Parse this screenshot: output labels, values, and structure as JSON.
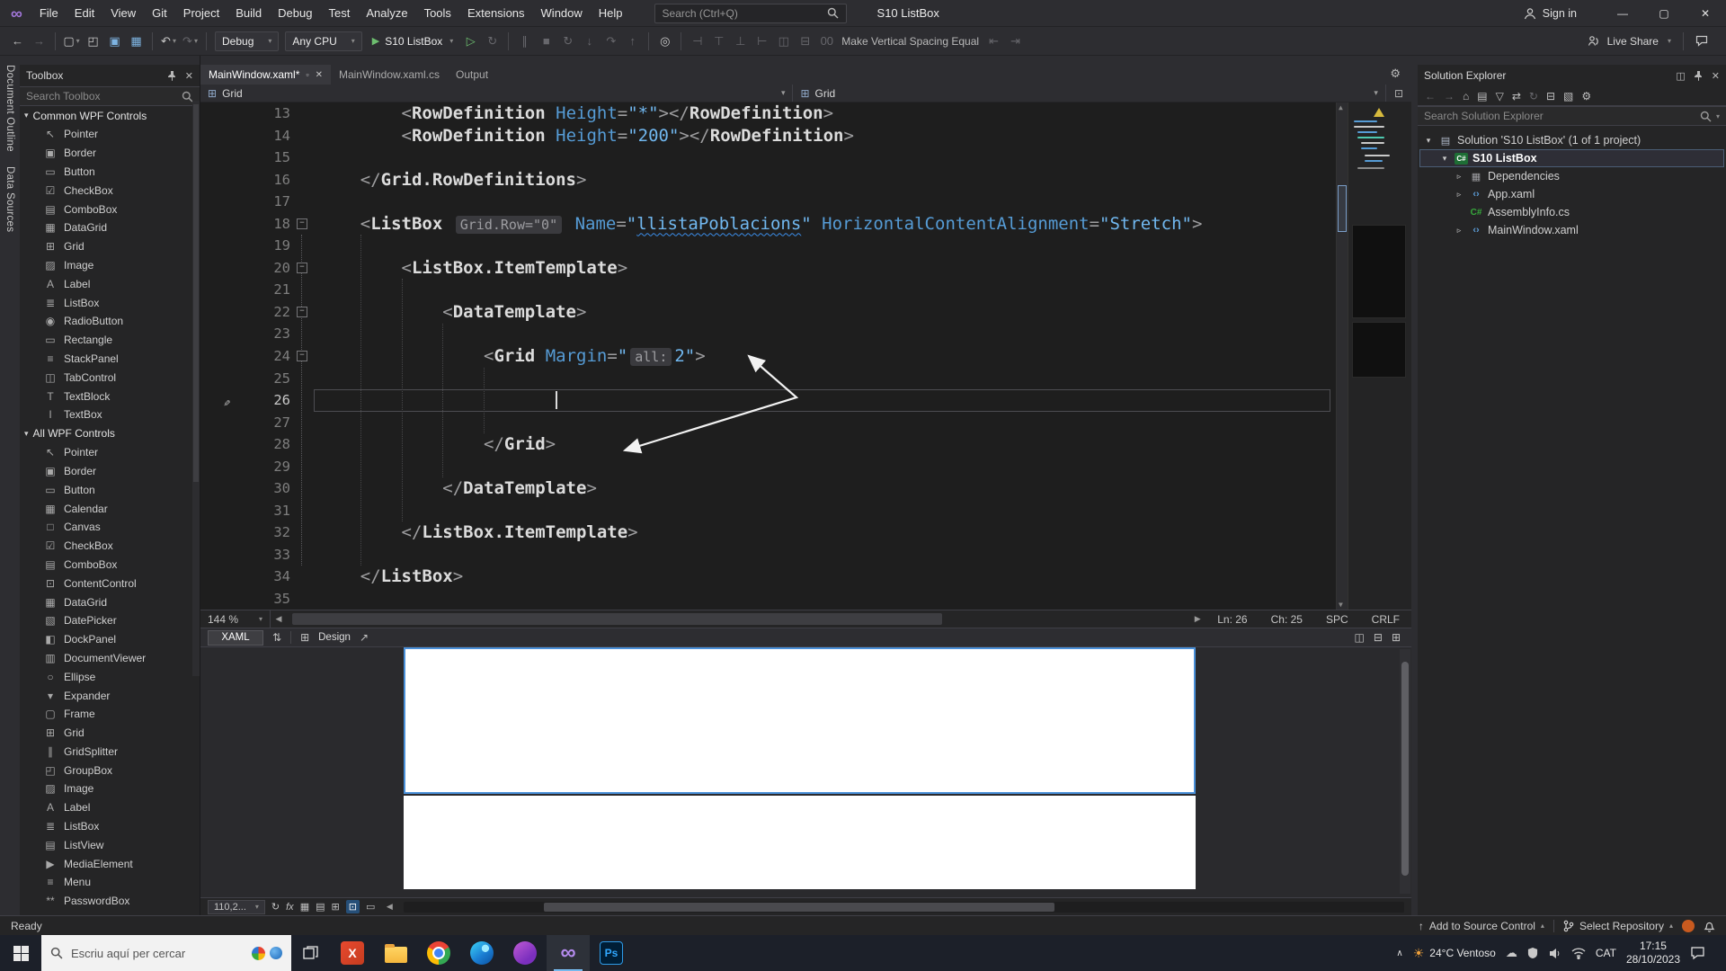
{
  "titlebar": {
    "menus": [
      "File",
      "Edit",
      "View",
      "Git",
      "Project",
      "Build",
      "Debug",
      "Test",
      "Analyze",
      "Tools",
      "Extensions",
      "Window",
      "Help"
    ],
    "search": "Search (Ctrl+Q)",
    "title": "S10 ListBox",
    "sign_in": "Sign in",
    "win_min": "—",
    "win_max": "▢",
    "win_close": "✕"
  },
  "toolbar": {
    "live_share": "Live Share",
    "items": [
      {
        "t": "icon",
        "n": "nav-back-icon",
        "g": "←"
      },
      {
        "t": "icon",
        "n": "nav-forward-icon",
        "g": "→",
        "d": 1
      },
      {
        "t": "sep"
      },
      {
        "t": "icon",
        "n": "new-file-icon",
        "g": "▢",
        "c": 1
      },
      {
        "t": "icon",
        "n": "open-file-icon",
        "g": "◰"
      },
      {
        "t": "icon",
        "n": "save-icon",
        "g": "▣",
        "tint": "#7EB4E2"
      },
      {
        "t": "icon",
        "n": "save-all-icon",
        "g": "▦",
        "tint": "#7EB4E2"
      },
      {
        "t": "sep"
      },
      {
        "t": "icon",
        "n": "undo-icon",
        "g": "↶",
        "c": 1
      },
      {
        "t": "icon",
        "n": "redo-icon",
        "g": "↷",
        "d": 1,
        "c": 1
      },
      {
        "t": "sep"
      },
      {
        "t": "dd",
        "n": "solution-configuration-dropdown",
        "label": "Debug"
      },
      {
        "t": "dd",
        "n": "solution-platform-dropdown",
        "label": "Any CPU"
      },
      {
        "t": "run",
        "n": "start-debugging-button",
        "label": "S10 ListBox"
      },
      {
        "t": "icon",
        "n": "start-without-debugging-icon",
        "g": "▷",
        "tint": "#6DBE6F"
      },
      {
        "t": "icon",
        "n": "hot-reload-icon",
        "g": "↻",
        "d": 1
      },
      {
        "t": "sep"
      },
      {
        "t": "icon",
        "n": "break-all-icon",
        "g": "∥",
        "d": 1
      },
      {
        "t": "icon",
        "n": "stop-icon",
        "g": "■",
        "d": 1
      },
      {
        "t": "icon",
        "n": "restart-icon",
        "g": "↻",
        "d": 1
      },
      {
        "t": "icon",
        "n": "step-into-icon",
        "g": "↓",
        "d": 1
      },
      {
        "t": "icon",
        "n": "step-over-icon",
        "g": "↷",
        "d": 1
      },
      {
        "t": "icon",
        "n": "step-out-icon",
        "g": "↑",
        "d": 1
      },
      {
        "t": "sep"
      },
      {
        "t": "icon",
        "n": "find-in-files-icon",
        "g": "◎"
      },
      {
        "t": "sep"
      },
      {
        "t": "icon",
        "n": "align-left-edges-icon",
        "g": "⊣",
        "d": 1
      },
      {
        "t": "icon",
        "n": "align-tops-icon",
        "g": "⊤",
        "d": 1
      },
      {
        "t": "icon",
        "n": "align-bottoms-icon",
        "g": "⊥",
        "d": 1
      },
      {
        "t": "icon",
        "n": "align-right-edges-icon",
        "g": "⊢",
        "d": 1
      },
      {
        "t": "icon",
        "n": "make-same-width-icon",
        "g": "◫",
        "d": 1
      },
      {
        "t": "icon",
        "n": "make-same-height-icon",
        "g": "⊟",
        "d": 1
      },
      {
        "t": "icon",
        "n": "make-same-size-icon",
        "g": "00",
        "d": 1
      },
      {
        "t": "label",
        "n": "spacing-command-label",
        "label": "Make Vertical Spacing Equal"
      },
      {
        "t": "icon",
        "n": "horizontal-spacing-icon",
        "g": "⇤",
        "d": 1
      },
      {
        "t": "icon",
        "n": "vertical-spacing-icon",
        "g": "⇥",
        "d": 1
      }
    ]
  },
  "side_tabs": [
    "Document Outline",
    "Data Sources"
  ],
  "toolbox": {
    "title": "Toolbox",
    "search_placeholder": "Search Toolbox",
    "sections": [
      {
        "label": "Common WPF Controls",
        "items": [
          {
            "label": "Pointer",
            "icon": "pointer",
            "g": "↖"
          },
          {
            "label": "Border",
            "icon": "border",
            "g": "▣"
          },
          {
            "label": "Button",
            "icon": "button",
            "g": "▭"
          },
          {
            "label": "CheckBox",
            "icon": "checkbox",
            "g": "☑"
          },
          {
            "label": "ComboBox",
            "icon": "combobox",
            "g": "▤"
          },
          {
            "label": "DataGrid",
            "icon": "datagrid",
            "g": "▦"
          },
          {
            "label": "Grid",
            "icon": "grid",
            "g": "⊞"
          },
          {
            "label": "Image",
            "icon": "image",
            "g": "▨"
          },
          {
            "label": "Label",
            "icon": "label",
            "g": "A"
          },
          {
            "label": "ListBox",
            "icon": "listbox",
            "g": "≣"
          },
          {
            "label": "RadioButton",
            "icon": "radiobutton",
            "g": "◉"
          },
          {
            "label": "Rectangle",
            "icon": "rectangle",
            "g": "▭"
          },
          {
            "label": "StackPanel",
            "icon": "stackpanel",
            "g": "≡"
          },
          {
            "label": "TabControl",
            "icon": "tabcontrol",
            "g": "◫"
          },
          {
            "label": "TextBlock",
            "icon": "textblock",
            "g": "T"
          },
          {
            "label": "TextBox",
            "icon": "textbox",
            "g": "I"
          }
        ]
      },
      {
        "label": "All WPF Controls",
        "items": [
          {
            "label": "Pointer",
            "icon": "pointer",
            "g": "↖"
          },
          {
            "label": "Border",
            "icon": "border",
            "g": "▣"
          },
          {
            "label": "Button",
            "icon": "button",
            "g": "▭"
          },
          {
            "label": "Calendar",
            "icon": "calendar",
            "g": "▦"
          },
          {
            "label": "Canvas",
            "icon": "canvas",
            "g": "□"
          },
          {
            "label": "CheckBox",
            "icon": "checkbox",
            "g": "☑"
          },
          {
            "label": "ComboBox",
            "icon": "combobox",
            "g": "▤"
          },
          {
            "label": "ContentControl",
            "icon": "contentcontrol",
            "g": "⊡"
          },
          {
            "label": "DataGrid",
            "icon": "datagrid",
            "g": "▦"
          },
          {
            "label": "DatePicker",
            "icon": "datepicker",
            "g": "▧"
          },
          {
            "label": "DockPanel",
            "icon": "dockpanel",
            "g": "◧"
          },
          {
            "label": "DocumentViewer",
            "icon": "documentviewer",
            "g": "▥"
          },
          {
            "label": "Ellipse",
            "icon": "ellipse",
            "g": "○"
          },
          {
            "label": "Expander",
            "icon": "expander",
            "g": "▾"
          },
          {
            "label": "Frame",
            "icon": "frame",
            "g": "▢"
          },
          {
            "label": "Grid",
            "icon": "grid",
            "g": "⊞"
          },
          {
            "label": "GridSplitter",
            "icon": "gridsplitter",
            "g": "∥"
          },
          {
            "label": "GroupBox",
            "icon": "groupbox",
            "g": "◰"
          },
          {
            "label": "Image",
            "icon": "image",
            "g": "▨"
          },
          {
            "label": "Label",
            "icon": "label",
            "g": "A"
          },
          {
            "label": "ListBox",
            "icon": "listbox",
            "g": "≣"
          },
          {
            "label": "ListView",
            "icon": "listview",
            "g": "▤"
          },
          {
            "label": "MediaElement",
            "icon": "mediaelement",
            "g": "▶"
          },
          {
            "label": "Menu",
            "icon": "menu",
            "g": "≡"
          },
          {
            "label": "PasswordBox",
            "icon": "passwordbox",
            "g": "**"
          }
        ]
      }
    ]
  },
  "editor": {
    "tabs": [
      {
        "label": "MainWindow.xaml*",
        "active": true
      },
      {
        "label": "MainWindow.xaml.cs"
      },
      {
        "label": "Output"
      }
    ],
    "breadcrumb": [
      "Grid",
      "Grid"
    ],
    "zoom": "144 %",
    "ln": "Ln: 26",
    "ch": "Ch: 25",
    "ins": "SPC",
    "eol": "CRLF",
    "fold_lines": [
      18,
      20,
      22,
      24
    ],
    "lines": [
      {
        "n": 13,
        "t": [
          [
            "        <",
            "pl"
          ],
          [
            "RowDefinition",
            "tag"
          ],
          [
            " ",
            "pl"
          ],
          [
            "Height",
            "at"
          ],
          [
            "=",
            "pl"
          ],
          [
            "\"*\"",
            "vl"
          ],
          [
            "></",
            "pl"
          ],
          [
            "RowDefinition",
            "tag"
          ],
          [
            ">",
            "pl"
          ]
        ]
      },
      {
        "n": 14,
        "t": [
          [
            "        <",
            "pl"
          ],
          [
            "RowDefinition",
            "tag"
          ],
          [
            " ",
            "pl"
          ],
          [
            "Height",
            "at"
          ],
          [
            "=",
            "pl"
          ],
          [
            "\"200\"",
            "vl"
          ],
          [
            "></",
            "pl"
          ],
          [
            "RowDefinition",
            "tag"
          ],
          [
            ">",
            "pl"
          ]
        ]
      },
      {
        "n": 15,
        "t": []
      },
      {
        "n": 16,
        "t": [
          [
            "    </",
            "pl"
          ],
          [
            "Grid.RowDefinitions",
            "tag"
          ],
          [
            ">",
            "pl"
          ]
        ]
      },
      {
        "n": 17,
        "t": []
      },
      {
        "n": 18,
        "t": [
          [
            "    <",
            "pl"
          ],
          [
            "ListBox",
            "tag"
          ],
          [
            " ",
            "pl"
          ],
          [
            "Grid.Row=\"0\"",
            "hint"
          ],
          [
            " ",
            "pl"
          ],
          [
            "Name",
            "at"
          ],
          [
            "=",
            "pl"
          ],
          [
            "\"",
            "vl"
          ],
          [
            "llistaPoblacions",
            "vlu"
          ],
          [
            "\"",
            "vl"
          ],
          [
            " ",
            "pl"
          ],
          [
            "HorizontalContentAlignment",
            "at"
          ],
          [
            "=",
            "pl"
          ],
          [
            "\"Stretch\"",
            "vl"
          ],
          [
            ">",
            "pl"
          ]
        ]
      },
      {
        "n": 19,
        "t": []
      },
      {
        "n": 20,
        "t": [
          [
            "        <",
            "pl"
          ],
          [
            "ListBox.ItemTemplate",
            "tag"
          ],
          [
            ">",
            "pl"
          ]
        ]
      },
      {
        "n": 21,
        "t": []
      },
      {
        "n": 22,
        "t": [
          [
            "            <",
            "pl"
          ],
          [
            "DataTemplate",
            "tag"
          ],
          [
            ">",
            "pl"
          ]
        ]
      },
      {
        "n": 23,
        "t": []
      },
      {
        "n": 24,
        "t": [
          [
            "                <",
            "pl"
          ],
          [
            "Grid",
            "tag"
          ],
          [
            " ",
            "pl"
          ],
          [
            "Margin",
            "at"
          ],
          [
            "=",
            "pl"
          ],
          [
            "\"",
            "vl"
          ],
          [
            "all:",
            "hint"
          ],
          [
            "2\"",
            "vl"
          ],
          [
            ">",
            "pl"
          ]
        ]
      },
      {
        "n": 25,
        "t": []
      },
      {
        "n": 26,
        "t": [],
        "cur": true
      },
      {
        "n": 27,
        "t": []
      },
      {
        "n": 28,
        "t": [
          [
            "                </",
            "pl"
          ],
          [
            "Grid",
            "tag"
          ],
          [
            ">",
            "pl"
          ]
        ]
      },
      {
        "n": 29,
        "t": []
      },
      {
        "n": 30,
        "t": [
          [
            "            </",
            "pl"
          ],
          [
            "DataTemplate",
            "tag"
          ],
          [
            ">",
            "pl"
          ]
        ]
      },
      {
        "n": 31,
        "t": []
      },
      {
        "n": 32,
        "t": [
          [
            "        </",
            "pl"
          ],
          [
            "ListBox.ItemTemplate",
            "tag"
          ],
          [
            ">",
            "pl"
          ]
        ]
      },
      {
        "n": 33,
        "t": []
      },
      {
        "n": 34,
        "t": [
          [
            "    </",
            "pl"
          ],
          [
            "ListBox",
            "tag"
          ],
          [
            ">",
            "pl"
          ]
        ]
      },
      {
        "n": 35,
        "t": []
      }
    ]
  },
  "design": {
    "xaml_label": "XAML",
    "design_label": "Design",
    "zoom": "110,2..."
  },
  "solution": {
    "title": "Solution Explorer",
    "search_placeholder": "Search Solution Explorer",
    "toolbar": [
      {
        "n": "se-back-icon",
        "g": "←",
        "d": 1
      },
      {
        "n": "se-forward-icon",
        "g": "→",
        "d": 1
      },
      {
        "n": "se-home-icon",
        "g": "⌂"
      },
      {
        "n": "se-switch-views-icon",
        "g": "▤"
      },
      {
        "n": "se-pending-changes-filter-icon",
        "g": "▽"
      },
      {
        "n": "se-sync-with-active-document-icon",
        "g": "⇄"
      },
      {
        "n": "se-refresh-icon",
        "g": "↻",
        "d": 1
      },
      {
        "n": "se-collapse-all-icon",
        "g": "⊟"
      },
      {
        "n": "se-show-all-files-icon",
        "g": "▧"
      },
      {
        "n": "se-properties-icon",
        "g": "⚙"
      }
    ],
    "tree": [
      {
        "lvl": 0,
        "arrow": "exp",
        "icon": "solution",
        "label": "Solution 'S10 ListBox' (1 of 1 project)"
      },
      {
        "lvl": 1,
        "arrow": "exp",
        "icon": "project",
        "label": "S10 ListBox",
        "sel": 1
      },
      {
        "lvl": 2,
        "arrow": "col",
        "icon": "deps",
        "label": "Dependencies"
      },
      {
        "lvl": 2,
        "arrow": "col",
        "icon": "xaml",
        "label": "App.xaml"
      },
      {
        "lvl": 2,
        "arrow": "none",
        "icon": "cs",
        "label": "AssemblyInfo.cs"
      },
      {
        "lvl": 2,
        "arrow": "col",
        "icon": "xaml",
        "label": "MainWindow.xaml"
      }
    ]
  },
  "statusbar": {
    "ready": "Ready",
    "add_source": "Add to Source Control",
    "select_repo": "Select Repository"
  },
  "taskbar": {
    "search_placeholder": "Escriu aquí per cercar",
    "weather": "24°C Ventoso",
    "language": "CAT",
    "time": "17:15",
    "date": "28/10/2023",
    "vs_glyph": "∞",
    "ps_glyph": "Ps",
    "x_glyph": "X"
  }
}
